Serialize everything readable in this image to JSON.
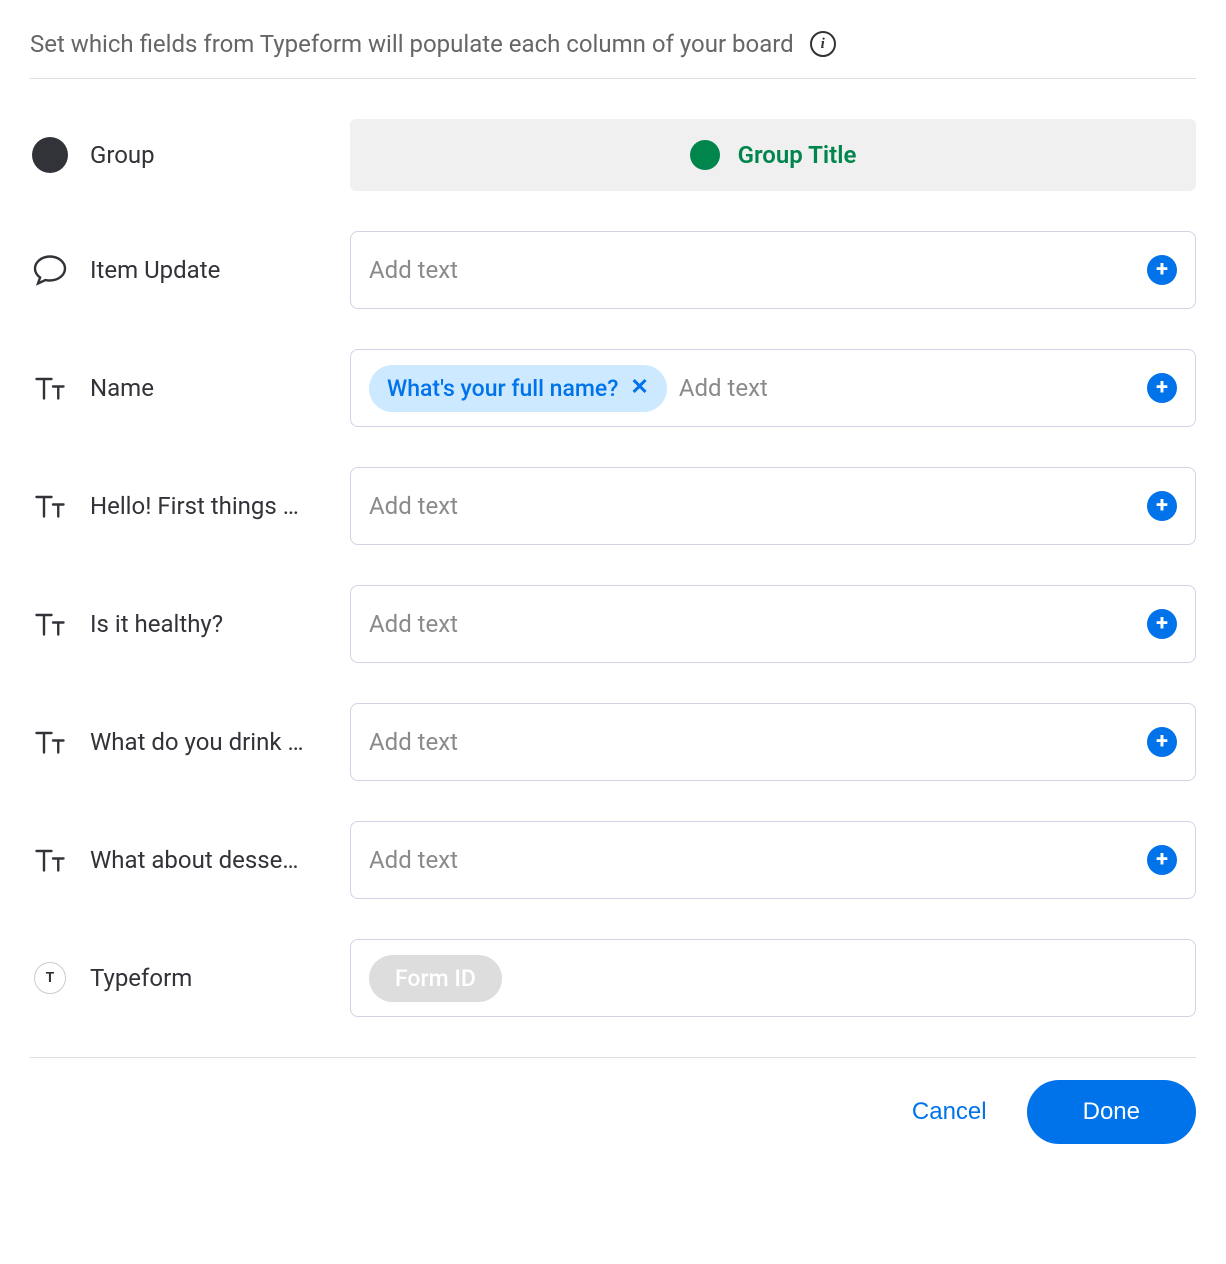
{
  "header": {
    "text": "Set which fields from Typeform will populate each column of your board"
  },
  "rows": [
    {
      "icon": "dark-circle",
      "label": "Group",
      "type": "locked",
      "locked_text": "Group Title"
    },
    {
      "icon": "speech",
      "label": "Item Update",
      "type": "input",
      "chips": [],
      "placeholder": "Add text"
    },
    {
      "icon": "text",
      "label": "Name",
      "type": "input",
      "chips": [
        {
          "text": "What's your full name?"
        }
      ],
      "placeholder": "Add text"
    },
    {
      "icon": "text",
      "label": "Hello! First things …",
      "type": "input",
      "chips": [],
      "placeholder": "Add text"
    },
    {
      "icon": "text",
      "label": "Is it healthy?",
      "type": "input",
      "chips": [],
      "placeholder": "Add text"
    },
    {
      "icon": "text",
      "label": "What do you drink …",
      "type": "input",
      "chips": [],
      "placeholder": "Add text"
    },
    {
      "icon": "text",
      "label": "What about desse…",
      "type": "input",
      "chips": [],
      "placeholder": "Add text"
    },
    {
      "icon": "typeform",
      "label": "Typeform",
      "type": "readonly",
      "chip_text": "Form ID"
    }
  ],
  "footer": {
    "cancel": "Cancel",
    "done": "Done"
  },
  "icon_glyphs": {
    "typeform_badge": "T",
    "info": "i",
    "chip_close": "✕",
    "add": "+"
  }
}
